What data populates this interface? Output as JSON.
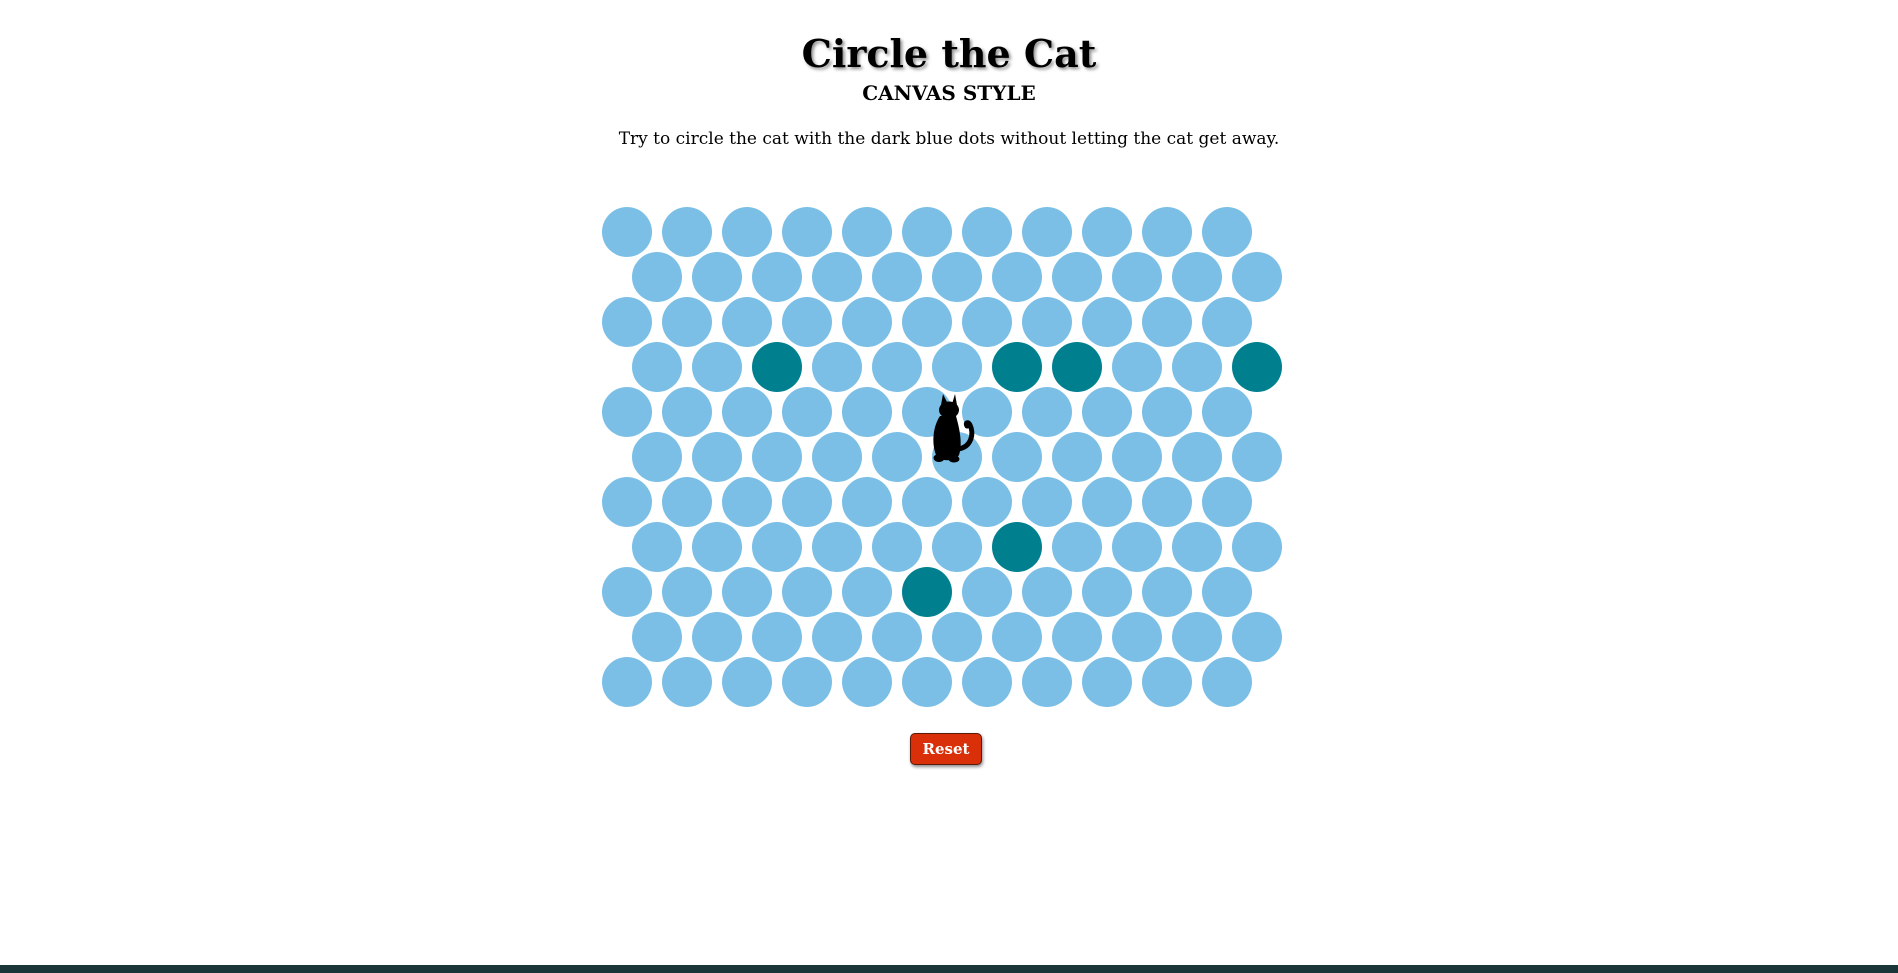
{
  "header": {
    "title": "Circle the Cat",
    "subtitle": "CANVAS STYLE",
    "instructions": "Try to circle the cat with the dark blue dots without letting the cat get away."
  },
  "board": {
    "rows": 11,
    "cols": 11,
    "free_color": "#7bbfe6",
    "blocked_color": "#00808f",
    "blocked_cells": [
      [
        3,
        2
      ],
      [
        3,
        6
      ],
      [
        3,
        7
      ],
      [
        3,
        10
      ],
      [
        7,
        6
      ],
      [
        8,
        5
      ]
    ],
    "cat_cell": [
      5,
      5
    ],
    "cat_icon": "cat-silhouette-icon"
  },
  "controls": {
    "reset_label": "Reset"
  },
  "colors": {
    "background": "#ffffff",
    "reset_button": "#d9300a",
    "bottom_bar": "#1b3638"
  }
}
